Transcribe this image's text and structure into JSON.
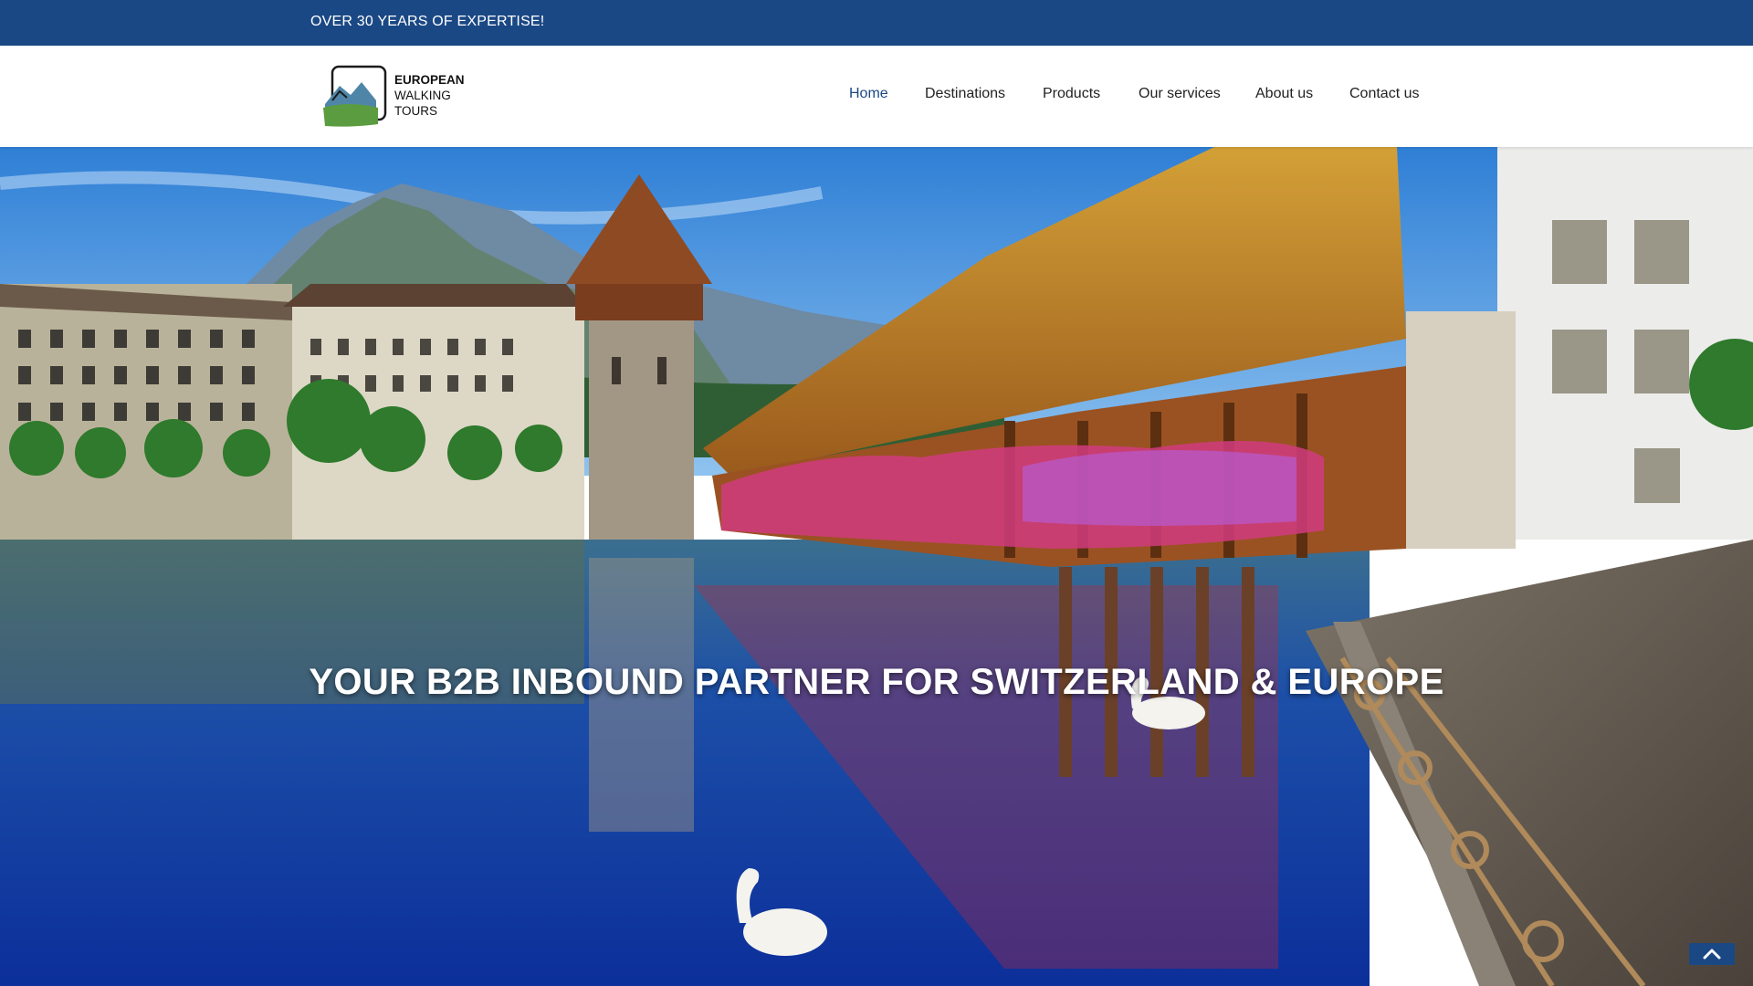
{
  "topbar": {
    "tagline": "OVER 30 YEARS OF EXPERTISE!"
  },
  "logo": {
    "line1": "EUROPEAN",
    "line2": "WALKING",
    "line3": "TOURS",
    "icon": "mountain-logo-icon"
  },
  "nav": {
    "items": [
      {
        "label": "Home",
        "active": true
      },
      {
        "label": "Destinations",
        "active": false
      },
      {
        "label": "Products",
        "active": false
      },
      {
        "label": "Our services",
        "active": false
      },
      {
        "label": "About us",
        "active": false
      },
      {
        "label": "Contact us",
        "active": false
      }
    ]
  },
  "hero": {
    "title": "YOUR B2B INBOUND PARTNER FOR SWITZERLAND & EUROPE"
  },
  "scroll_top": {
    "icon": "chevron-up-icon"
  },
  "colors": {
    "brand": "#1a4884",
    "text": "#222222",
    "white": "#ffffff"
  }
}
